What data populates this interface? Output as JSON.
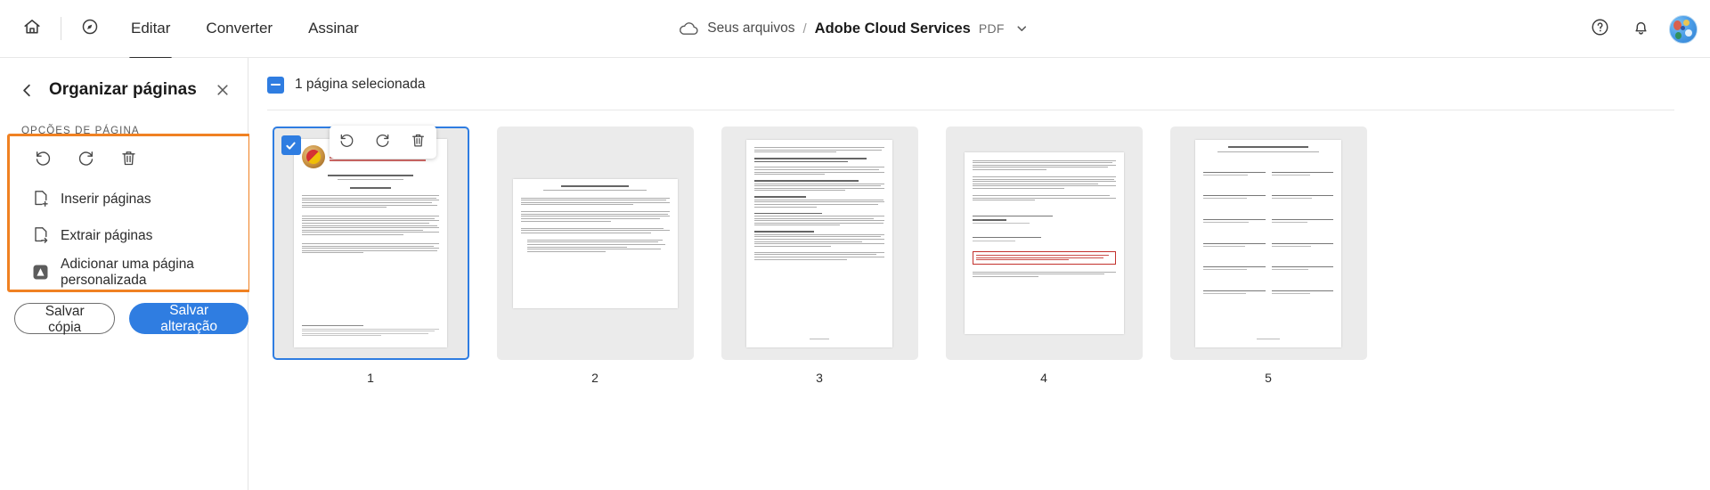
{
  "topbar": {
    "home_icon": "home-icon",
    "search_icon": "search-tools-icon",
    "tabs": [
      {
        "label": "Editar",
        "active": true
      },
      {
        "label": "Converter",
        "active": false
      },
      {
        "label": "Assinar",
        "active": false
      }
    ],
    "breadcrumb": {
      "cloud_icon": "cloud-icon",
      "root": "Seus arquivos",
      "separator": "/",
      "current": "Adobe Cloud Services",
      "file_type": "PDF",
      "caret_icon": "chevron-down-icon"
    },
    "help_icon": "help-circle-icon",
    "bell_icon": "notification-bell-icon",
    "avatar_name": "user-avatar"
  },
  "panel": {
    "back_icon": "chevron-left-icon",
    "title": "Organizar páginas",
    "close_icon": "close-icon",
    "section_label": "OPÇÕES DE PÁGINA",
    "rotate_left_icon": "rotate-left-icon",
    "rotate_right_icon": "rotate-right-icon",
    "delete_icon": "trash-icon",
    "options": [
      {
        "label": "Inserir páginas",
        "icon": "page-insert-icon"
      },
      {
        "label": "Extrair páginas",
        "icon": "page-extract-icon"
      },
      {
        "label": "Adicionar uma página personalizada",
        "icon": "adobe-custom-page-icon"
      }
    ],
    "save_copy_label": "Salvar cópia",
    "save_change_label": "Salvar alteração",
    "highlight_color": "#f08122"
  },
  "main": {
    "selection_text": "1 página selecionada",
    "selection_checkbox_state": "indeterminate",
    "accent_color": "#2f7de1",
    "thumb_toolbar": {
      "rotate_left_icon": "rotate-left-icon",
      "rotate_right_icon": "rotate-right-icon",
      "delete_icon": "trash-icon"
    },
    "pages": [
      {
        "number": "1",
        "selected": true,
        "doc_kind": "liability-waiver-cover"
      },
      {
        "number": "2",
        "selected": false,
        "doc_kind": "participant-agreement"
      },
      {
        "number": "3",
        "selected": false,
        "doc_kind": "terms-dense"
      },
      {
        "number": "4",
        "selected": false,
        "doc_kind": "signature-page"
      },
      {
        "number": "5",
        "selected": false,
        "doc_kind": "under-18-form"
      }
    ]
  }
}
